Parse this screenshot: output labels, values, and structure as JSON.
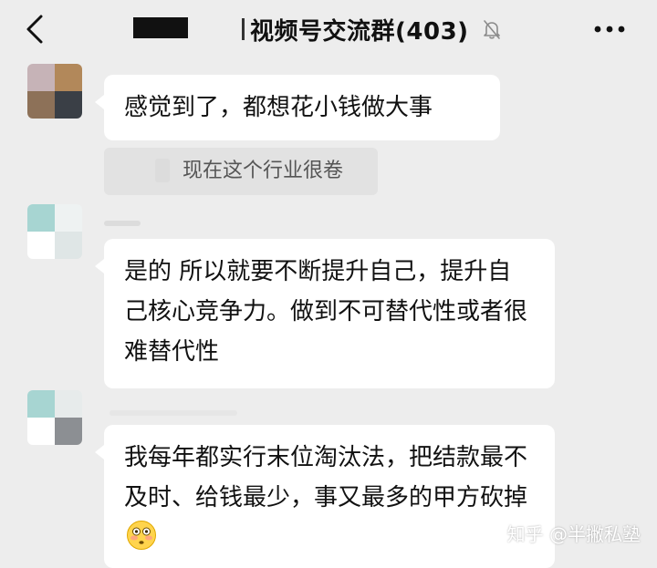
{
  "header": {
    "title": "视频号交流群(403)",
    "back_icon": "chevron-left-icon",
    "mute_icon": "bell-muted-icon",
    "more_icon": "more-horizontal-icon"
  },
  "messages": [
    {
      "text": "感觉到了，都想花小钱做大事",
      "quote": "现在这个行业很卷"
    },
    {
      "text": "是的  所以就要不断提升自己，提升自己核心竞争力。做到不可替代性或者很难替代性"
    },
    {
      "text": "我每年都实行末位淘汰法，把结款最不及时、给钱最少，事又最多的甲方砍掉",
      "emoji": "flushed-face-emoji"
    }
  ],
  "watermark": {
    "text": "知乎 @半撇私塾"
  },
  "colors": {
    "background": "#ededed",
    "bubble": "#ffffff",
    "quote_bg": "#e2e2e2",
    "quote_text": "#555555"
  }
}
